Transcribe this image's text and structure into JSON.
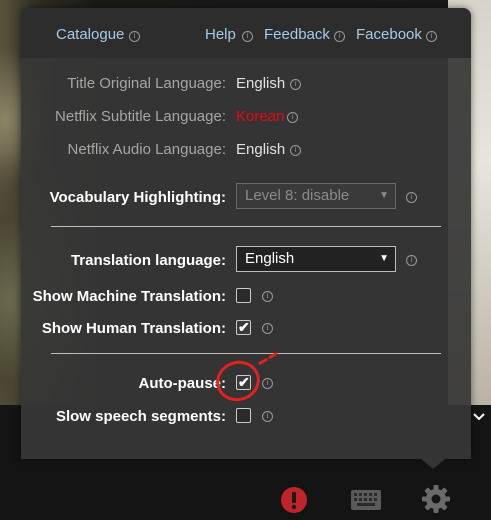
{
  "header": {
    "catalogue": "Catalogue",
    "help": "Help",
    "feedback": "Feedback",
    "facebook": "Facebook",
    "info_glyph": "i"
  },
  "languages": {
    "title_original_label": "Title Original Language:",
    "title_original_value": "English",
    "netflix_subtitle_label": "Netflix Subtitle Language:",
    "netflix_subtitle_value": "Korean",
    "netflix_audio_label": "Netflix Audio Language:",
    "netflix_audio_value": "English"
  },
  "vocabulary": {
    "label": "Vocabulary Highlighting:",
    "selected": "Level 8: disable"
  },
  "translation": {
    "label": "Translation language:",
    "selected": "English",
    "machine_label": "Show Machine Translation:",
    "machine_checked": false,
    "human_label": "Show Human Translation:",
    "human_checked": true
  },
  "playback": {
    "autopause_label": "Auto-pause:",
    "autopause_checked": true,
    "slow_label": "Slow speech segments:",
    "slow_checked": false
  },
  "glyphs": {
    "check": "✔",
    "dropdown_arrow": "▼",
    "chevron": "⌄"
  },
  "icons": {
    "alert": "alert-icon",
    "keyboard": "keyboard-icon",
    "settings": "gear-icon"
  },
  "colors": {
    "link": "#a3cbe8",
    "subtitle_red": "#e50914",
    "alert_red": "#c0232b",
    "annotation": "#e52020"
  }
}
